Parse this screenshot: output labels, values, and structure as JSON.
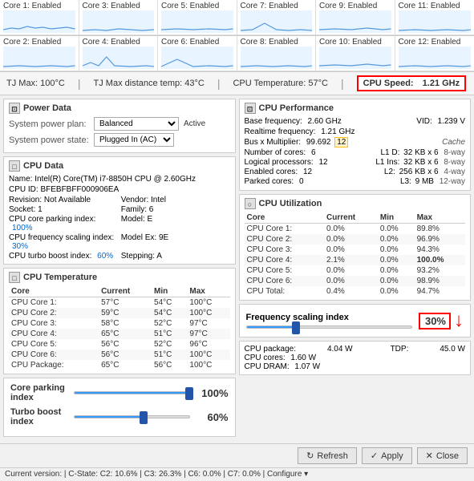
{
  "cores_top": [
    {
      "label": "Core 1: Enabled"
    },
    {
      "label": "Core 3: Enabled"
    },
    {
      "label": "Core 5: Enabled"
    },
    {
      "label": "Core 7: Enabled"
    },
    {
      "label": "Core 9: Enabled"
    },
    {
      "label": "Core 11: Enabled"
    }
  ],
  "cores_bottom": [
    {
      "label": "Core 2: Enabled"
    },
    {
      "label": "Core 4: Enabled"
    },
    {
      "label": "Core 6: Enabled"
    },
    {
      "label": "Core 8: Enabled"
    },
    {
      "label": "Core 10: Enabled"
    },
    {
      "label": "Core 12: Enabled"
    }
  ],
  "tj": {
    "max": "TJ Max: 100°C",
    "distance": "TJ Max distance temp:  43°C",
    "temperature": "CPU Temperature:  57°C",
    "speed_label": "CPU Speed:",
    "speed_value": "1.21 GHz"
  },
  "power": {
    "section_title": "Power Data",
    "plan_label": "System power plan:",
    "plan_value": "Balanced",
    "active_label": "Active",
    "state_label": "System power state:",
    "state_value": "Plugged In (AC)"
  },
  "cpu_data": {
    "section_title": "CPU Data",
    "name_label": "Name:",
    "name_value": "Intel(R) Core(TM) i7-8850H CPU @ 2.60GHz",
    "id_label": "CPU ID:",
    "id_value": "BFEBFBFF000906EA",
    "revision_label": "Revision:",
    "revision_value": "Not Available",
    "vendor_label": "Vendor:",
    "vendor_value": "Intel",
    "socket_label": "Socket:",
    "socket_value": "1",
    "family_label": "Family:",
    "family_value": "6",
    "parking_label": "CPU core parking index:",
    "parking_value": "100%",
    "model_label": "Model:",
    "model_value": "E",
    "frequency_label": "CPU frequency scaling index:",
    "frequency_value": "30%",
    "model_ex_label": "Model Ex:",
    "model_ex_value": "9E",
    "turbo_label": "CPU turbo boost index:",
    "turbo_value": "60%",
    "stepping_label": "Stepping:",
    "stepping_value": "A"
  },
  "cpu_temp": {
    "section_title": "CPU Temperature",
    "headers": [
      "Core",
      "Current",
      "Min",
      "Max"
    ],
    "rows": [
      {
        "core": "CPU Core 1:",
        "current": "57°C",
        "min": "54°C",
        "max": "100°C"
      },
      {
        "core": "CPU Core 2:",
        "current": "59°C",
        "min": "54°C",
        "max": "100°C"
      },
      {
        "core": "CPU Core 3:",
        "current": "58°C",
        "min": "52°C",
        "max": "97°C"
      },
      {
        "core": "CPU Core 4:",
        "current": "65°C",
        "min": "51°C",
        "max": "97°C"
      },
      {
        "core": "CPU Core 5:",
        "current": "56°C",
        "min": "52°C",
        "max": "96°C"
      },
      {
        "core": "CPU Core 6:",
        "current": "56°C",
        "min": "51°C",
        "max": "100°C"
      },
      {
        "core": "CPU Package:",
        "current": "65°C",
        "min": "56°C",
        "max": "100°C"
      }
    ]
  },
  "cpu_perf": {
    "section_title": "CPU Performance",
    "base_freq_label": "Base frequency:",
    "base_freq_value": "2.60 GHz",
    "vid_label": "VID:",
    "vid_value": "1.239 V",
    "realtime_label": "Realtime frequency:",
    "realtime_value": "1.21 GHz",
    "bus_label": "Bus x Multiplier:",
    "bus_value": "99.692",
    "multiplier_value": "12",
    "cache_label": "Cache",
    "cores_label": "Number of cores:",
    "cores_value": "6",
    "l1d_label": "L1 D:",
    "l1d_value": "32 KB x 6",
    "l1d_way": "8-way",
    "logical_label": "Logical processors:",
    "logical_value": "12",
    "l1i_label": "L1 Ins:",
    "l1i_value": "32 KB x 6",
    "l1i_way": "8-way",
    "enabled_label": "Enabled cores:",
    "enabled_value": "12",
    "l2_label": "L2:",
    "l2_value": "256 KB x 6",
    "l2_way": "4-way",
    "parked_label": "Parked cores:",
    "parked_value": "0",
    "l3_label": "L3:",
    "l3_value": "9 MB",
    "l3_way": "12-way"
  },
  "cpu_util": {
    "section_title": "CPU Utilization",
    "headers": [
      "Core",
      "Current",
      "Min",
      "Max"
    ],
    "rows": [
      {
        "core": "CPU Core 1:",
        "current": "0.0%",
        "min": "0.0%",
        "max": "89.8%"
      },
      {
        "core": "CPU Core 2:",
        "current": "0.0%",
        "min": "0.0%",
        "max": "96.9%"
      },
      {
        "core": "CPU Core 3:",
        "current": "0.0%",
        "min": "0.0%",
        "max": "94.3%"
      },
      {
        "core": "CPU Core 4:",
        "current": "2.1%",
        "min": "0.0%",
        "max": "100.0%"
      },
      {
        "core": "CPU Core 5:",
        "current": "0.0%",
        "min": "0.0%",
        "max": "93.2%"
      },
      {
        "core": "CPU Core 6:",
        "current": "0.0%",
        "min": "0.0%",
        "max": "98.9%"
      },
      {
        "core": "CPU Total:",
        "current": "0.4%",
        "min": "0.0%",
        "max": "94.7%"
      }
    ]
  },
  "sliders": {
    "parking_label": "Core parking index",
    "parking_value": "100%",
    "parking_pct": 100,
    "frequency_label": "Frequency scaling index",
    "frequency_value": "30%",
    "frequency_pct": 30,
    "turbo_label": "Turbo boost index",
    "turbo_value": "60%",
    "turbo_pct": 60
  },
  "buttons": {
    "refresh_label": "Refresh",
    "apply_label": "Apply",
    "close_label": "Close"
  },
  "status_bar": {
    "text": "Current version:     | C-State:  C2:  10.6%  |  C3:  26.3%  |  C6:  0.0%  |  C7:  0.0%  |  Configure ▾"
  }
}
